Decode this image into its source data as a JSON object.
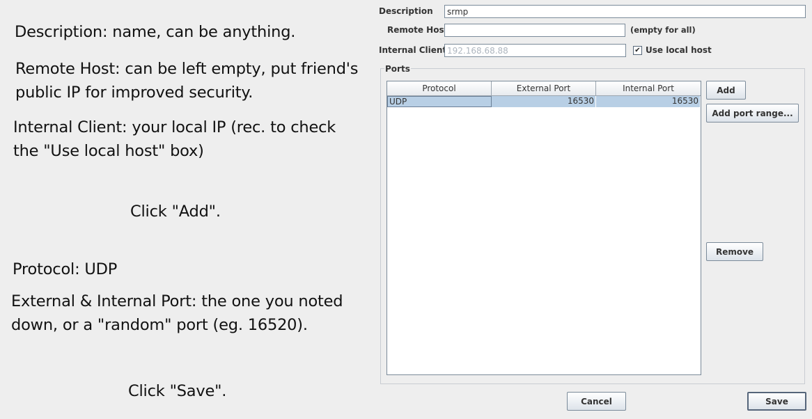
{
  "notes": [
    "Description: name, can be anything.",
    "Remote Host: can be left empty, put friend's",
    "public IP for improved security.",
    "Internal Client: your local IP (rec. to check",
    "the \"Use local host\" box)",
    "Click \"Add\".",
    "Protocol: UDP",
    "External & Internal Port: the one you noted",
    "down, or a \"random\" port (eg. 16520).",
    "Click \"Save\"."
  ],
  "form": {
    "description_label": "Description",
    "description_value": "srmp",
    "remote_host_label": "Remote Host",
    "remote_host_value": "",
    "remote_host_hint": "(empty for all)",
    "internal_client_label": "Internal Client",
    "internal_client_value": "192.168.68.88",
    "use_local_host_label": "Use local host",
    "use_local_host_checked": "✔"
  },
  "ports": {
    "title": "Ports",
    "columns": [
      "Protocol",
      "External Port",
      "Internal Port"
    ],
    "rows": [
      {
        "protocol": "UDP",
        "external": "16530",
        "internal": "16530"
      }
    ],
    "add_label": "Add",
    "add_range_label": "Add port range...",
    "remove_label": "Remove"
  },
  "footer": {
    "cancel_label": "Cancel",
    "save_label": "Save"
  }
}
